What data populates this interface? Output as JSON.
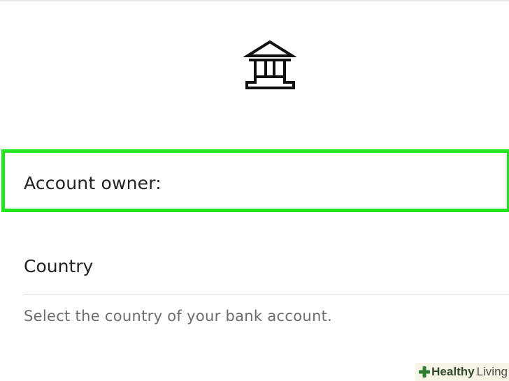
{
  "icons": {
    "bank": "bank-icon",
    "watermark": "plus-icon"
  },
  "form": {
    "account_owner_label": "Account owner:",
    "country_label": "Country",
    "country_helper": "Select the country of your bank account."
  },
  "watermark": {
    "brand_bold": "Healthy",
    "brand_light": "Living"
  },
  "colors": {
    "highlight": "#22e51f",
    "text": "#222222",
    "helper_text": "#6d6d6d",
    "watermark_plus": "#2e7d32"
  }
}
